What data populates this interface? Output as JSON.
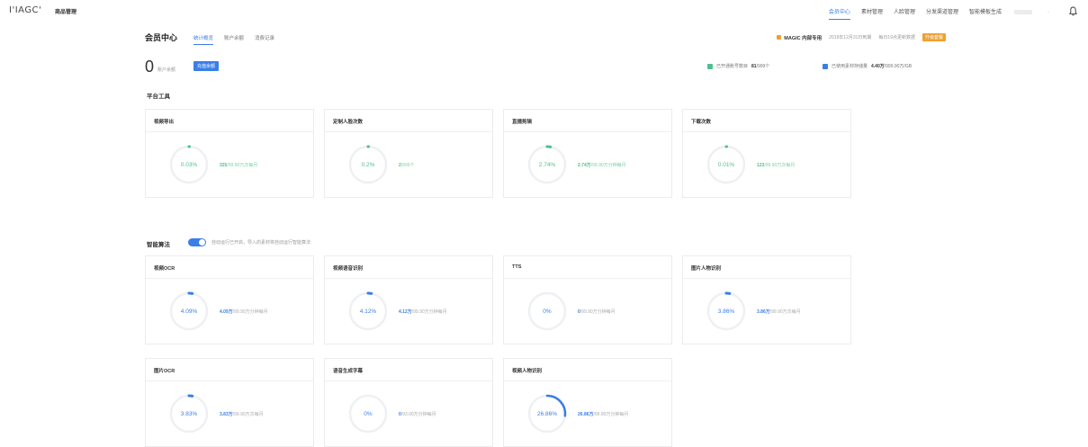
{
  "app": {
    "logo": "I'IAGC'",
    "title": "商品管理"
  },
  "nav": {
    "items": [
      {
        "label": "会员中心",
        "active": true
      },
      {
        "label": "素材管理",
        "active": false
      },
      {
        "label": "人脸管理",
        "active": false
      },
      {
        "label": "分发渠道管理",
        "active": false
      },
      {
        "label": "智能模板生成",
        "active": false
      }
    ],
    "user_dot": "·"
  },
  "header": {
    "title": "会员中心",
    "tabs": [
      {
        "label": "统计概览",
        "active": true
      },
      {
        "label": "账户余额",
        "active": false
      },
      {
        "label": "消费记录",
        "active": false
      }
    ],
    "brand": "MAGIC 内部专用",
    "meta1": "2019年12月31日到期",
    "meta2": "每日19点更新数据",
    "badge": "升级套餐"
  },
  "balance": {
    "value": "0",
    "label": "账户余额",
    "recharge_label": "充值余额",
    "stats": [
      {
        "label": "已开通账号数目",
        "value": "81",
        "rest": "/999个",
        "color": "#4fc08d"
      },
      {
        "label": "已使用素材存储量",
        "value": "4.40万",
        "rest": "/999.90万/GB",
        "color": "#3a7ee8"
      }
    ]
  },
  "platform": {
    "title": "平台工具",
    "cards": [
      {
        "title": "视频导出",
        "percent": "0.03%",
        "pct_value": 0.03,
        "used": "325",
        "rest": "/99.90万次每月"
      },
      {
        "title": "定制人脸次数",
        "percent": "0.2%",
        "pct_value": 0.2,
        "used": "2",
        "rest": "/999个"
      },
      {
        "title": "直播剪辑",
        "percent": "2.74%",
        "pct_value": 2.74,
        "used": "2.74万",
        "rest": "/99.90万分钟每月"
      },
      {
        "title": "下载次数",
        "percent": "0.01%",
        "pct_value": 0.01,
        "used": "123",
        "rest": "/99.90万次每月"
      }
    ]
  },
  "smart": {
    "title": "智能算法",
    "toggle_on": true,
    "toggle_text": "自动运行已开启，导入的素材将自动运行智能算法",
    "cards": [
      {
        "title": "视频OCR",
        "percent": "4.09%",
        "pct_value": 4.09,
        "used": "4.09万",
        "rest": "/99.90万分钟每月"
      },
      {
        "title": "视频语音识别",
        "percent": "4.12%",
        "pct_value": 4.12,
        "used": "4.12万",
        "rest": "/99.90万分钟每月"
      },
      {
        "title": "TTS",
        "percent": "0%",
        "pct_value": 0,
        "used": "0",
        "rest": "/99.90万分钟每月"
      },
      {
        "title": "图片人物识别",
        "percent": "3.86%",
        "pct_value": 3.86,
        "used": "3.86万",
        "rest": "/99.90万次每月"
      },
      {
        "title": "图片OCR",
        "percent": "3.83%",
        "pct_value": 3.83,
        "used": "3.83万",
        "rest": "/99.90万次每月"
      },
      {
        "title": "语音生成字幕",
        "percent": "0%",
        "pct_value": 0,
        "used": "0",
        "rest": "/93.00万分钟每月"
      },
      {
        "title": "视频人物识别",
        "percent": "26.86%",
        "pct_value": 26.86,
        "used": "26.86万",
        "rest": "/99.90万分钟每月"
      }
    ]
  },
  "colors": {
    "accent": "#3a7ee8",
    "green": "#4fc08d",
    "ring_track": "#eef0f3"
  }
}
